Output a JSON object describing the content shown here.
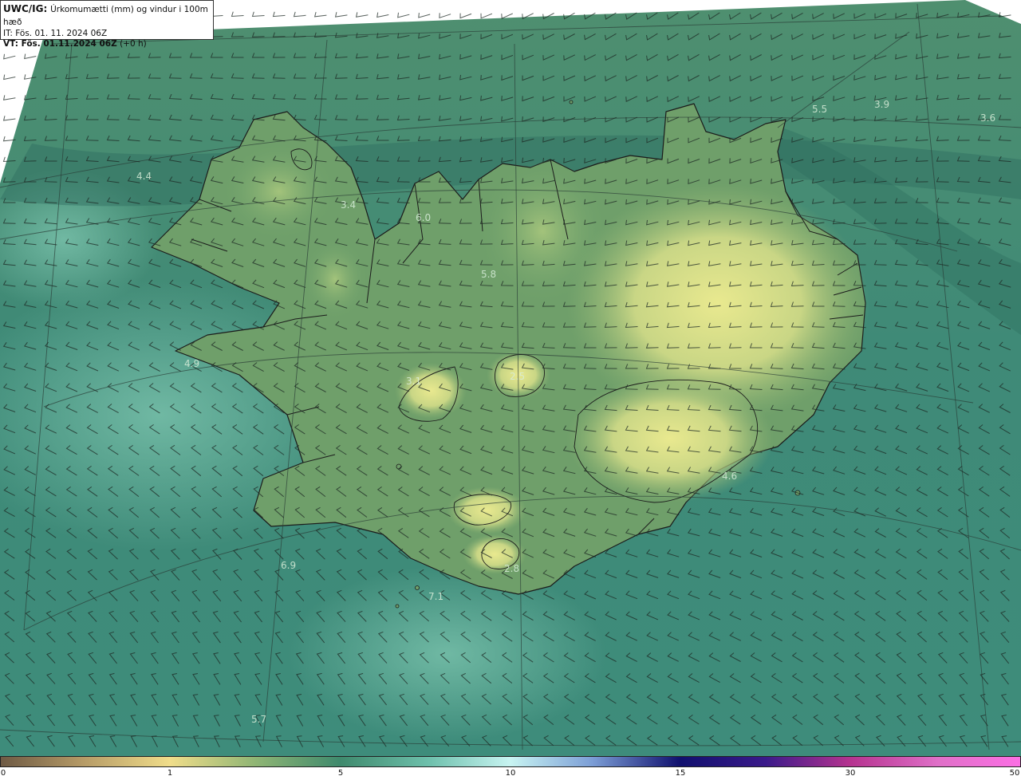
{
  "header": {
    "product": "UWC/IG:",
    "parameter": "Úrkomumætti (mm) og vindur i 100m hæð",
    "init_time": "IT: Fös. 01. 11. 2024 06Z",
    "valid_label": "VT: Fös. 01.11.2024 06Z",
    "lead": "(+0 h)"
  },
  "map_values": [
    {
      "id": "v1",
      "text": "5.5"
    },
    {
      "id": "v2",
      "text": "3.9"
    },
    {
      "id": "v3",
      "text": "3.6"
    },
    {
      "id": "v4",
      "text": "4.4"
    },
    {
      "id": "v5",
      "text": "3.4"
    },
    {
      "id": "v6",
      "text": "6.0"
    },
    {
      "id": "v7",
      "text": "5.8"
    },
    {
      "id": "v8",
      "text": "4.9"
    },
    {
      "id": "v9",
      "text": "3.1"
    },
    {
      "id": "v10",
      "text": "2.5"
    },
    {
      "id": "v11",
      "text": "4.6"
    },
    {
      "id": "v12",
      "text": "6.9"
    },
    {
      "id": "v13",
      "text": "2.8"
    },
    {
      "id": "v14",
      "text": "7.1"
    },
    {
      "id": "v15",
      "text": "5.7"
    }
  ],
  "colorbar": {
    "ticks": [
      {
        "label": "0"
      },
      {
        "label": "1"
      },
      {
        "label": "5"
      },
      {
        "label": "10"
      },
      {
        "label": "15"
      },
      {
        "label": "30"
      },
      {
        "label": "50"
      }
    ]
  },
  "colors": {
    "ocean": "#3f8a77",
    "ocean_light": "#6db8a4",
    "land_low": "#5f9a6a",
    "land_high": "#e6e78c",
    "coastline": "#1b1b1b"
  }
}
